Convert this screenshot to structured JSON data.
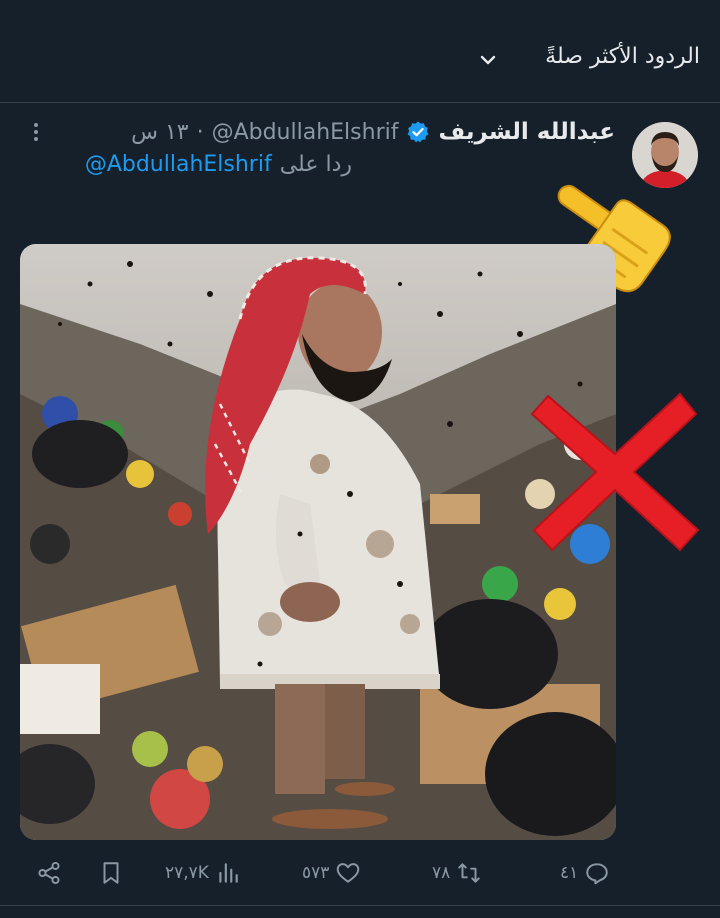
{
  "sort": {
    "label": "الردود الأكثر صلةً"
  },
  "tweet": {
    "author_name": "عبدالله الشريف",
    "handle": "@AbdullahElshrif",
    "separator": "·",
    "time": "١٣ س",
    "reply_prefix": "ردا على",
    "reply_handle": "@AbdullahElshrif"
  },
  "media": {
    "description": ""
  },
  "actions": {
    "reply_count": "٤١",
    "retweet_count": "٧٨",
    "like_count": "٥٧٣",
    "views_count": "٢٧,٧K"
  },
  "colors": {
    "background": "#15202b",
    "accent": "#1d9bf0",
    "muted": "#8b98a5",
    "text": "#e7e9ea"
  },
  "icons": [
    "chevron-down-icon",
    "verified-badge-icon",
    "more-icon",
    "pointing-hand-icon",
    "red-x-icon",
    "reply-icon",
    "retweet-icon",
    "like-icon",
    "views-icon",
    "bookmark-icon",
    "share-icon"
  ]
}
